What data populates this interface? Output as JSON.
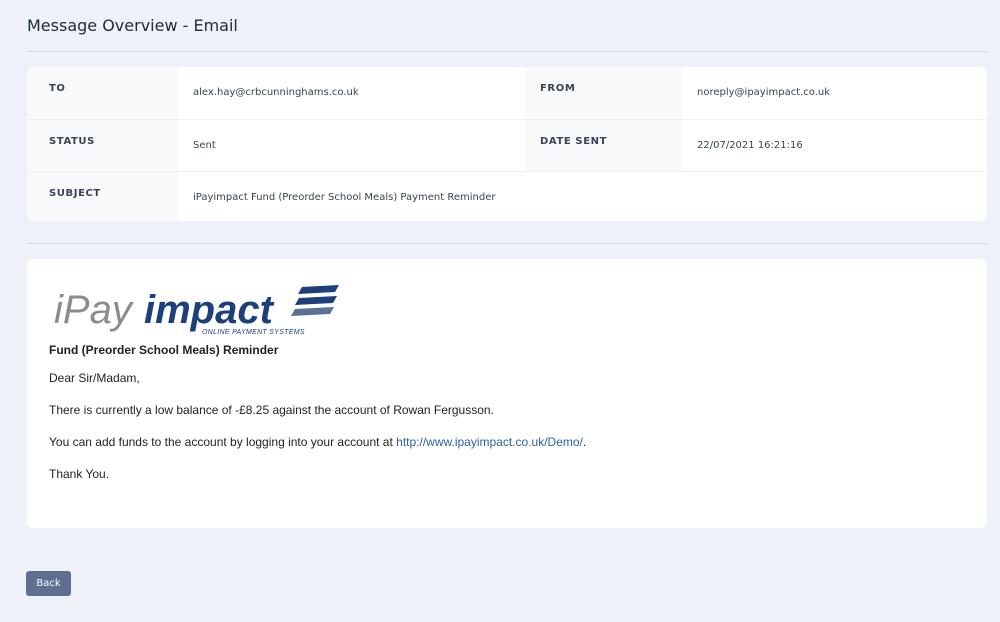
{
  "page": {
    "title": "Message Overview - Email"
  },
  "details": {
    "to_label": "TO",
    "to_value": "alex.hay@crbcunninghams.co.uk",
    "from_label": "FROM",
    "from_value": "noreply@ipayimpact.co.uk",
    "status_label": "STATUS",
    "status_value": "Sent",
    "date_sent_label": "DATE SENT",
    "date_sent_value": "22/07/2021 16:21:16",
    "subject_label": "SUBJECT",
    "subject_value": "iPayimpact Fund (Preorder School Meals) Payment Reminder"
  },
  "email": {
    "logo": {
      "text_ipay": "iPay",
      "text_impact": "impact",
      "tagline": "ONLINE PAYMENT SYSTEMS"
    },
    "heading": "Fund (Preorder School Meals) Reminder",
    "greeting": "Dear Sir/Madam,",
    "line1": "There is currently a low balance of -£8.25 against the account of Rowan Fergusson.",
    "line2_prefix": "You can add funds to the account by logging into your account at ",
    "line2_link": "http://www.ipayimpact.co.uk/Demo/",
    "line2_suffix": ".",
    "sign_off": "Thank You."
  },
  "actions": {
    "back_label": "Back"
  },
  "colors": {
    "background": "#eef1f8",
    "button": "#5f6f8f",
    "link": "#2a62a8",
    "logo_grey": "#8c8c8c",
    "logo_navy": "#1d3f7a"
  }
}
